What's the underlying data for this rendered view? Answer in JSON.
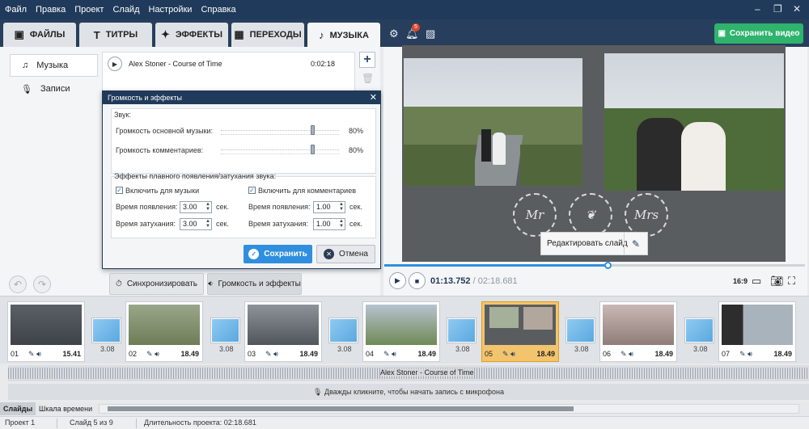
{
  "menu": {
    "items": [
      "Файл",
      "Правка",
      "Проект",
      "Слайд",
      "Настройки",
      "Справка"
    ]
  },
  "window_controls": {
    "minimize": "–",
    "restore": "❐",
    "close": "✕"
  },
  "tabs": [
    {
      "label": "ФАЙЛЫ",
      "icon": "files-icon"
    },
    {
      "label": "ТИТРЫ",
      "icon": "titles-icon"
    },
    {
      "label": "ЭФФЕКТЫ",
      "icon": "effects-icon"
    },
    {
      "label": "ПЕРЕХОДЫ",
      "icon": "transitions-icon"
    },
    {
      "label": "МУЗЫКА",
      "icon": "music-icon"
    }
  ],
  "toolbar": {
    "notifications_count": "5",
    "save_video_label": "Сохранить видео"
  },
  "music_panel": {
    "side_items": [
      "Музыка",
      "Записи"
    ],
    "tracks": [
      {
        "title": "Alex Stoner - Course of Time",
        "duration": "0:02:18"
      }
    ]
  },
  "dialog": {
    "title": "Громкость и эффекты",
    "sound_group": "Звук:",
    "main_music_label": "Громкость основной музыки:",
    "main_music_value": "80%",
    "main_music_level": 0.8,
    "comments_label": "Громкость комментариев:",
    "comments_value": "80%",
    "comments_level": 0.8,
    "fade_group": "Эффекты плавного появления/затухания звука:",
    "music_enable": "Включить для музыки",
    "comments_enable": "Включить для комментариев",
    "appear_label": "Время появления:",
    "fade_label": "Время затухания:",
    "music_appear": "3.00",
    "music_fade": "3.00",
    "comments_appear": "1.00",
    "comments_fade": "1.00",
    "unit": "сек.",
    "save": "Сохранить",
    "cancel": "Отмена"
  },
  "controls": {
    "sync": "Синхронизировать",
    "volume_effects": "Громкость и эффекты"
  },
  "preview": {
    "edit_slide": "Редактировать слайд",
    "current_time": "01:13.752",
    "total_time": "02:18.681",
    "time_separator": "/",
    "progress": 0.53,
    "aspect": "16:9",
    "wreath_left": "Mr",
    "wreath_right": "Mrs"
  },
  "slides": [
    {
      "num": "01",
      "dur": "15.41"
    },
    {
      "num": "02",
      "dur": "18.49"
    },
    {
      "num": "03",
      "dur": "18.49"
    },
    {
      "num": "04",
      "dur": "18.49"
    },
    {
      "num": "05",
      "dur": "18.49"
    },
    {
      "num": "06",
      "dur": "18.49"
    },
    {
      "num": "07",
      "dur": "18.49"
    }
  ],
  "transitions": [
    "3.08",
    "3.08",
    "3.08",
    "3.08",
    "3.08",
    "3.08"
  ],
  "timeline": {
    "audio_label": "Alex Stoner - Course of Time",
    "mic_hint": "Дважды кликните, чтобы начать запись с микрофона"
  },
  "bottom_tabs": [
    "Слайды",
    "Шкала времени"
  ],
  "status": {
    "project": "Проект 1",
    "slide": "Слайд 5 из 9",
    "duration": "Длительность проекта: 02:18.681"
  }
}
